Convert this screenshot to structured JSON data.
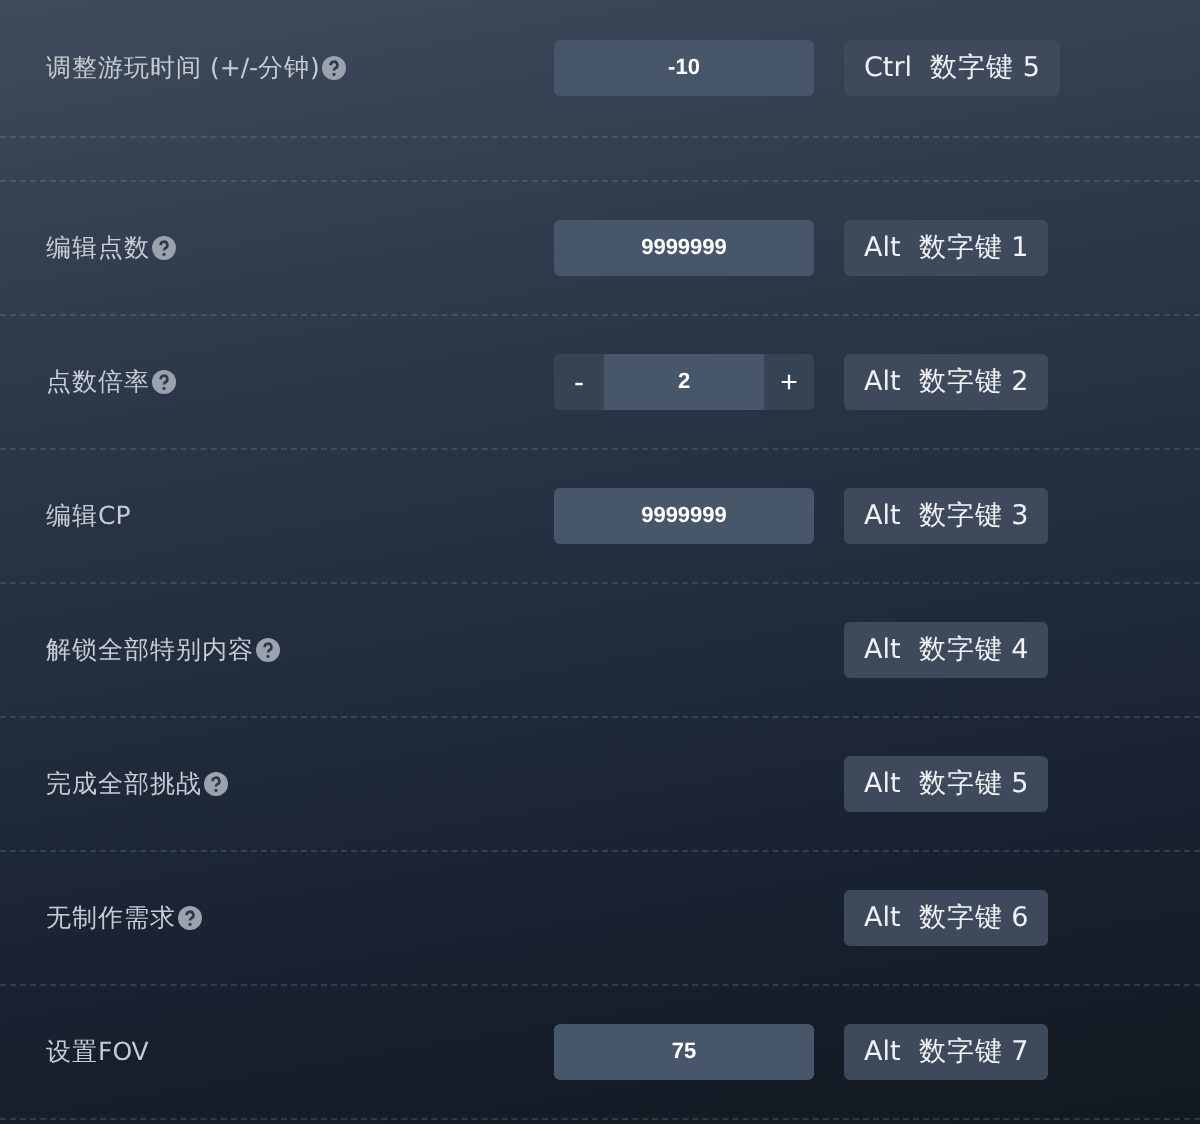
{
  "rows": [
    {
      "label": "调整游玩时间 (+/-分钟)",
      "help": true,
      "kind": "number",
      "value": "-10",
      "hotkey": {
        "modifier": "Ctrl",
        "key": "数字键 5"
      }
    },
    {
      "kind": "spacer"
    },
    {
      "label": "编辑点数",
      "help": true,
      "kind": "number",
      "value": "9999999",
      "hotkey": {
        "modifier": "Alt",
        "key": "数字键 1"
      }
    },
    {
      "label": "点数倍率",
      "help": true,
      "kind": "stepper",
      "value": "2",
      "decrement": "-",
      "increment": "+",
      "hotkey": {
        "modifier": "Alt",
        "key": "数字键 2"
      }
    },
    {
      "label": "编辑CP",
      "help": false,
      "kind": "number",
      "value": "9999999",
      "hotkey": {
        "modifier": "Alt",
        "key": "数字键 3"
      }
    },
    {
      "label": "解锁全部特别内容",
      "help": true,
      "kind": "toggle",
      "hotkey": {
        "modifier": "Alt",
        "key": "数字键 4"
      }
    },
    {
      "label": "完成全部挑战",
      "help": true,
      "kind": "toggle",
      "hotkey": {
        "modifier": "Alt",
        "key": "数字键 5"
      }
    },
    {
      "label": "无制作需求",
      "help": true,
      "kind": "toggle",
      "hotkey": {
        "modifier": "Alt",
        "key": "数字键 6"
      }
    },
    {
      "label": "设置FOV",
      "help": false,
      "kind": "number",
      "value": "75",
      "hotkey": {
        "modifier": "Alt",
        "key": "数字键 7"
      }
    }
  ]
}
